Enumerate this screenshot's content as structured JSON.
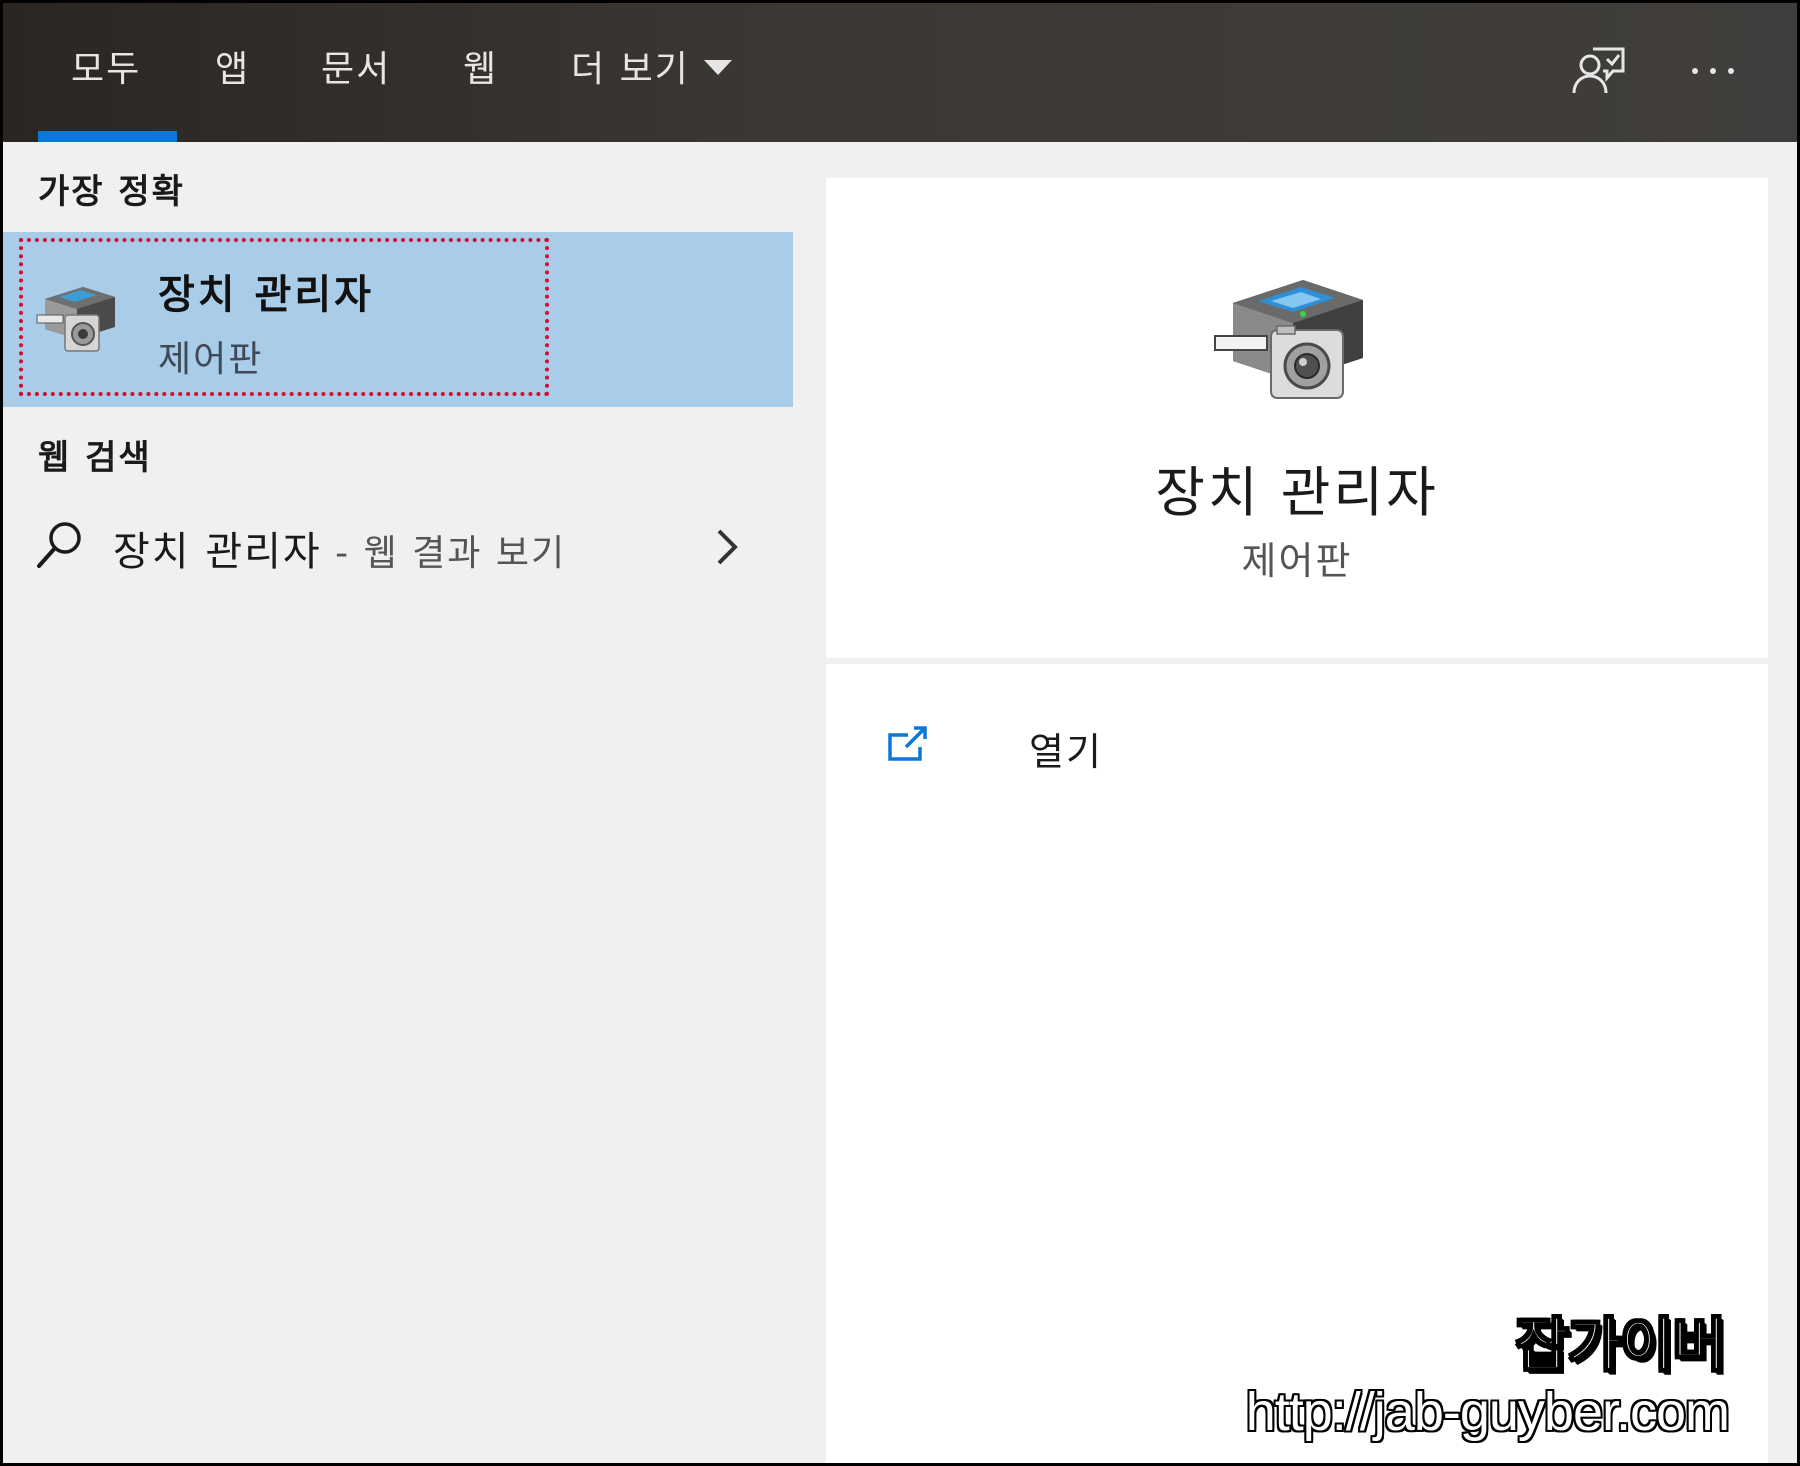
{
  "tabs": [
    {
      "label": "모두",
      "active": true
    },
    {
      "label": "앱"
    },
    {
      "label": "문서"
    },
    {
      "label": "웹"
    },
    {
      "label": "더 보기"
    }
  ],
  "top_icons": {
    "feedback": "feedback-person-icon",
    "more": "ellipsis-icon"
  },
  "left": {
    "best_match_heading": "가장 정확",
    "best_match": {
      "title": "장치 관리자",
      "subtitle": "제어판",
      "icon": "device-manager-icon"
    },
    "web_heading": "웹 검색",
    "web_result": {
      "query": "장치 관리자",
      "suffix": " - 웹 결과 보기"
    }
  },
  "right": {
    "title": "장치 관리자",
    "subtitle": "제어판",
    "actions": [
      {
        "label": "열기",
        "icon": "open-icon"
      }
    ]
  },
  "watermark": {
    "name": "잡가이버",
    "url": "http://jab-guyber.com"
  },
  "colors": {
    "accent": "#0a78d7",
    "selection": "#a9cce9",
    "highlight_border": "#d0102c"
  }
}
